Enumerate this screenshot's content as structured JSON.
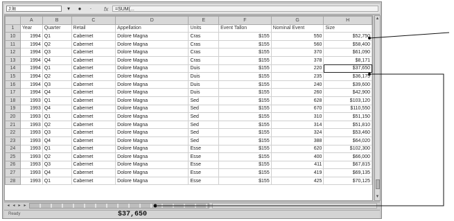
{
  "formula_bar": {
    "name_box": "J:ltt",
    "fx_icon": "fx",
    "formula": "=SUM(..."
  },
  "columns": [
    "A",
    "B",
    "C",
    "D",
    "E",
    "F",
    "G",
    "H"
  ],
  "header_row": {
    "row_number": "1",
    "cells": [
      "Year",
      "Quarter",
      "Retail",
      "Appellation",
      "Units",
      "Event Tallon",
      "Nominal Event",
      "Size"
    ]
  },
  "rows": [
    {
      "row": "10",
      "cells": [
        "1994",
        "Q1",
        "Cabernet",
        "Dolore Magna",
        "Cras",
        "$155",
        "550",
        "$52,750"
      ]
    },
    {
      "row": "11",
      "cells": [
        "1994",
        "Q2",
        "Cabernet",
        "Dolore Magna",
        "Cras",
        "$155",
        "560",
        "$58,400"
      ]
    },
    {
      "row": "12",
      "cells": [
        "1994",
        "Q3",
        "Cabernet",
        "Dolore Magna",
        "Cras",
        "$155",
        "370",
        "$61,090"
      ]
    },
    {
      "row": "13",
      "cells": [
        "1994",
        "Q4",
        "Cabernet",
        "Dolore Magna",
        "Cras",
        "$155",
        "378",
        "$8,171"
      ]
    },
    {
      "row": "14",
      "cells": [
        "1994",
        "Q1",
        "Cabernet",
        "Dolore Magna",
        "Duis",
        "$155",
        "220",
        "$37,650"
      ]
    },
    {
      "row": "15",
      "cells": [
        "1994",
        "Q2",
        "Cabernet",
        "Dolore Magna",
        "Duis",
        "$155",
        "235",
        "$36,175"
      ]
    },
    {
      "row": "16",
      "cells": [
        "1994",
        "Q3",
        "Cabernet",
        "Dolore Magna",
        "Duis",
        "$155",
        "240",
        "$39,600"
      ]
    },
    {
      "row": "17",
      "cells": [
        "1994",
        "Q4",
        "Cabernet",
        "Dolore Magna",
        "Duis",
        "$155",
        "260",
        "$42,900"
      ]
    },
    {
      "row": "18",
      "cells": [
        "1993",
        "Q1",
        "Cabernet",
        "Dolore Magna",
        "Sed",
        "$155",
        "628",
        "$103,120"
      ]
    },
    {
      "row": "19",
      "cells": [
        "1993",
        "Q4",
        "Cabernet",
        "Dolore Magna",
        "Sed",
        "$155",
        "670",
        "$110,550"
      ]
    },
    {
      "row": "20",
      "cells": [
        "1993",
        "Q1",
        "Cabernet",
        "Dolore Magna",
        "Sed",
        "$155",
        "310",
        "$51,150"
      ]
    },
    {
      "row": "21",
      "cells": [
        "1993",
        "Q2",
        "Cabernet",
        "Dolore Magna",
        "Sed",
        "$155",
        "314",
        "$51,810"
      ]
    },
    {
      "row": "22",
      "cells": [
        "1993",
        "Q3",
        "Cabernet",
        "Dolore Magna",
        "Sed",
        "$155",
        "324",
        "$53,460"
      ]
    },
    {
      "row": "23",
      "cells": [
        "1993",
        "Q4",
        "Cabernet",
        "Dolore Magna",
        "Sed",
        "$155",
        "388",
        "$64,020"
      ]
    },
    {
      "row": "24",
      "cells": [
        "1993",
        "Q1",
        "Cabernet",
        "Dolore Magna",
        "Esse",
        "$155",
        "620",
        "$102,300"
      ]
    },
    {
      "row": "25",
      "cells": [
        "1993",
        "Q2",
        "Cabernet",
        "Dolore Magna",
        "Esse",
        "$155",
        "400",
        "$66,000"
      ]
    },
    {
      "row": "26",
      "cells": [
        "1993",
        "Q3",
        "Cabernet",
        "Dolore Magna",
        "Esse",
        "$155",
        "411",
        "$67,815"
      ]
    },
    {
      "row": "27",
      "cells": [
        "1993",
        "Q4",
        "Cabernet",
        "Dolore Magna",
        "Esse",
        "$155",
        "419",
        "$69,135"
      ]
    },
    {
      "row": "28",
      "cells": [
        "1993",
        "Q1",
        "Cabernet",
        "Dolore Magna",
        "Esse",
        "$155",
        "425",
        "$70,125"
      ]
    }
  ],
  "selected_cell": "H14",
  "status_bar": {
    "ready": "Ready",
    "sum": "$37,650"
  },
  "colors": {
    "grid_bg": "#ffffff",
    "header_bg": "#d8d8d8",
    "window_bg": "#c8c8c8",
    "callout_line": "#111111"
  }
}
